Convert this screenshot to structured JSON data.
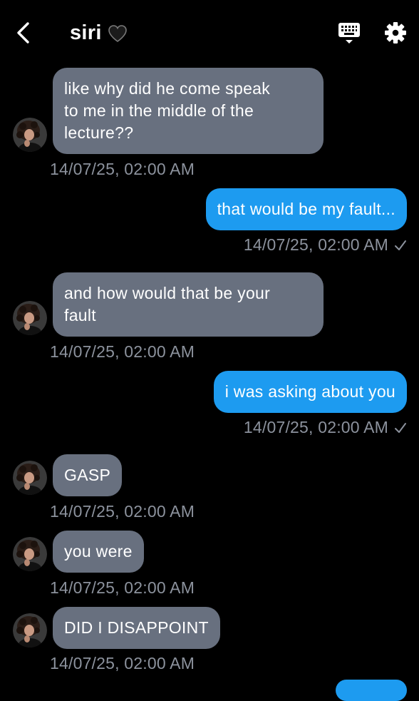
{
  "header": {
    "title": "siri",
    "back_icon": "chevron-left-icon",
    "heart_icon": "black-heart-icon",
    "keyboard_icon": "keyboard-icon",
    "settings_icon": "gear-icon"
  },
  "colors": {
    "background": "#000000",
    "incoming_bubble": "#68707f",
    "outgoing_bubble": "#1d9bf0",
    "timestamp": "#8c929d"
  },
  "messages": [
    {
      "direction": "in",
      "lines": [
        "like why did he come speak",
        "to me in the middle of the",
        "lecture??"
      ],
      "time": "14/07/25, 02:00 AM"
    },
    {
      "direction": "out",
      "lines": [
        "that would be my fault..."
      ],
      "time": "14/07/25, 02:00 AM",
      "read": true
    },
    {
      "direction": "in",
      "lines": [
        "and how would that be your",
        "fault"
      ],
      "time": "14/07/25, 02:00 AM"
    },
    {
      "direction": "out",
      "lines": [
        "i was asking about you"
      ],
      "time": "14/07/25, 02:00 AM",
      "read": true
    },
    {
      "direction": "in",
      "lines": [
        "GASP"
      ],
      "time": "14/07/25, 02:00 AM"
    },
    {
      "direction": "in",
      "lines": [
        "you were"
      ],
      "time": "14/07/25, 02:00 AM"
    },
    {
      "direction": "in",
      "lines": [
        "DID I DISAPPOINT"
      ],
      "time": "14/07/25, 02:00 AM"
    }
  ]
}
